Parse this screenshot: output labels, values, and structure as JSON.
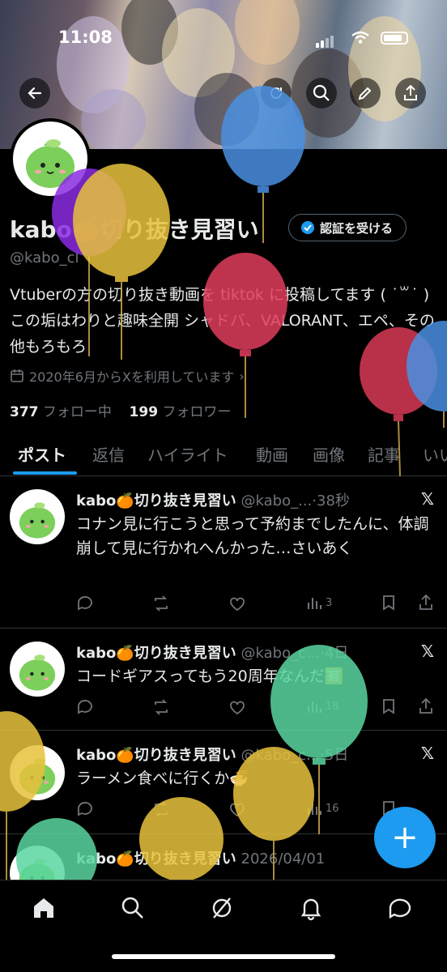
{
  "status_bar": {
    "time": "11:08"
  },
  "profile": {
    "display_name": "kabo🍊切り抜き見習い",
    "handle": "@kabo_cl",
    "verify_button": "認証を受ける",
    "bio": "Vtuberの方の切り抜き動画を tiktok に投稿してます ( ˙꒳˙ ) この垢はわりと趣味全開 シャドバ、VALORANT、エペ、その他もろもろ",
    "joined": "2020年6月からXを利用しています",
    "following_count": "377",
    "following_label": "フォロー中",
    "followers_count": "199",
    "followers_label": "フォロワー"
  },
  "tabs": [
    {
      "label": "ポスト"
    },
    {
      "label": "返信"
    },
    {
      "label": "ハイライト"
    },
    {
      "label": "動画"
    },
    {
      "label": "画像"
    },
    {
      "label": "記事"
    },
    {
      "label": "いい"
    }
  ],
  "posts": [
    {
      "name": "kabo🍊切り抜き見習い",
      "handle": "@kabo_...",
      "time": "·38秒",
      "text": "コナン見に行こうと思って予約までしたんに、体調崩して見に行かれへんかった…さいあく",
      "views": "3"
    },
    {
      "name": "kabo🍊切り抜き見習い",
      "handle": "@kabo_c...",
      "time": "·4日",
      "text": "コードギアスってもう20周年なんだ🈶",
      "views": "18"
    },
    {
      "name": "kabo🍊切り抜き見習い",
      "handle": "@kabo_c...",
      "time": "·5日",
      "text": "ラーメン食べに行くか🍜",
      "views": "16"
    },
    {
      "name": "kabo🍊切り抜き見習い",
      "handle": "",
      "time": "2026/04/01",
      "text": "",
      "views": ""
    }
  ],
  "fab_label": "+",
  "colors": {
    "accent": "#1d9bf0",
    "background": "#000000",
    "muted": "#71767b"
  }
}
